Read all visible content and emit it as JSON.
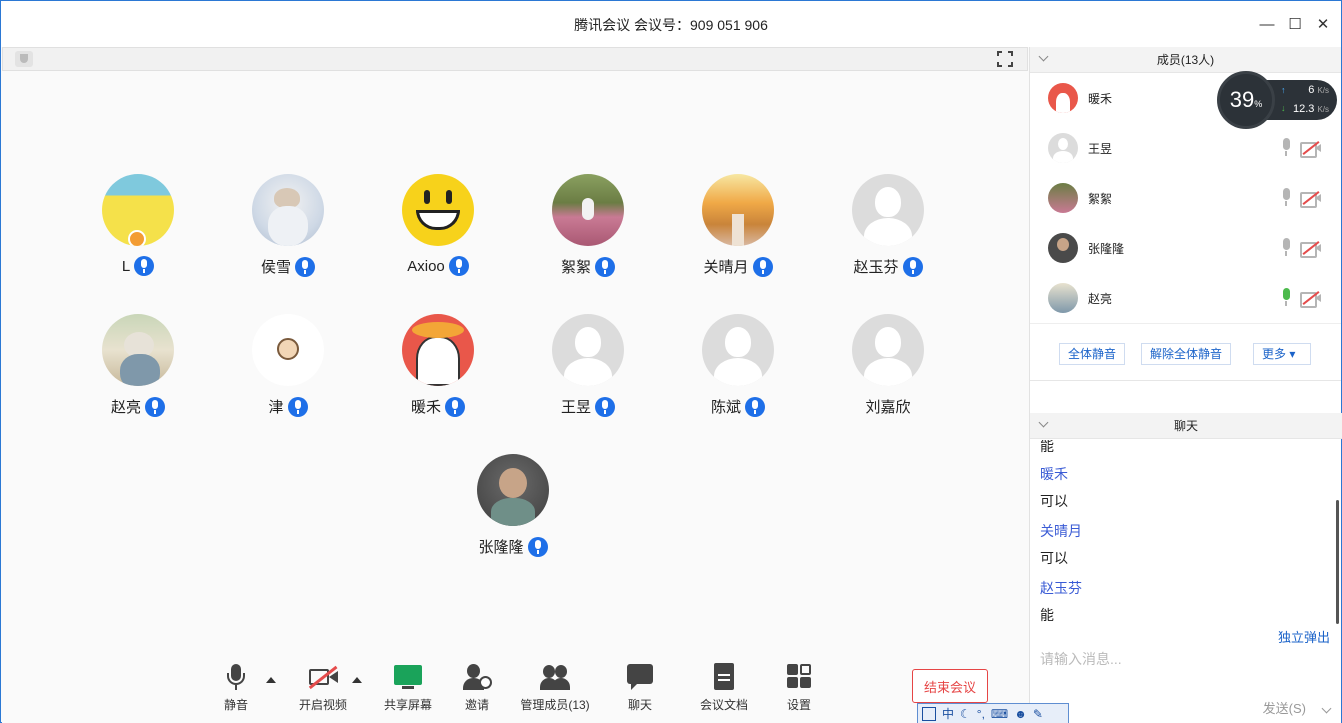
{
  "window": {
    "title": "腾讯会议 会议号：909 051 906",
    "controls": {
      "minimize": "—",
      "maximize": "☐",
      "close": "✕"
    }
  },
  "grid": [
    {
      "name": "L",
      "host": true
    },
    {
      "name": "侯雪"
    },
    {
      "name": "Axioo"
    },
    {
      "name": "絮絮"
    },
    {
      "name": "关晴月"
    },
    {
      "name": "赵玉芬"
    },
    {
      "name": "赵亮"
    },
    {
      "name": "津"
    },
    {
      "name": "暖禾"
    },
    {
      "name": "王昱"
    },
    {
      "name": "陈斌"
    },
    {
      "name": "刘嘉欣"
    },
    {
      "name": "张隆隆"
    }
  ],
  "toolbar": {
    "mute": "静音",
    "video": "开启视频",
    "share": "共享屏幕",
    "invite": "邀请",
    "manage": "管理成员(13)",
    "chat": "聊天",
    "docs": "会议文档",
    "settings": "设置",
    "end": "结束会议"
  },
  "members": {
    "header": "成员(13人)",
    "list": [
      {
        "name": "暖禾"
      },
      {
        "name": "王昱"
      },
      {
        "name": "絮絮"
      },
      {
        "name": "张隆隆"
      },
      {
        "name": "赵亮"
      }
    ],
    "mute_all": "全体静音",
    "unmute_all": "解除全体静音",
    "more": "更多 ▾"
  },
  "chat": {
    "header": "聊天",
    "messages": [
      {
        "text": "能"
      },
      {
        "text": "暖禾",
        "sender": true
      },
      {
        "text": "可以"
      },
      {
        "text": "关晴月",
        "sender": true
      },
      {
        "text": "可以"
      },
      {
        "text": "赵玉芬",
        "sender": true
      },
      {
        "text": "能"
      }
    ],
    "popout": "独立弹出",
    "placeholder": "请输入消息...",
    "send": "发送(S)"
  },
  "netspeed": {
    "percent": "39",
    "percent_unit": "%",
    "up": "6",
    "down": "12.3",
    "unit": "K/s"
  },
  "ime": {
    "label": "中"
  },
  "colors": {
    "accent": "#1e6fe8",
    "danger": "#e64545",
    "sender": "#3a5bd5"
  }
}
